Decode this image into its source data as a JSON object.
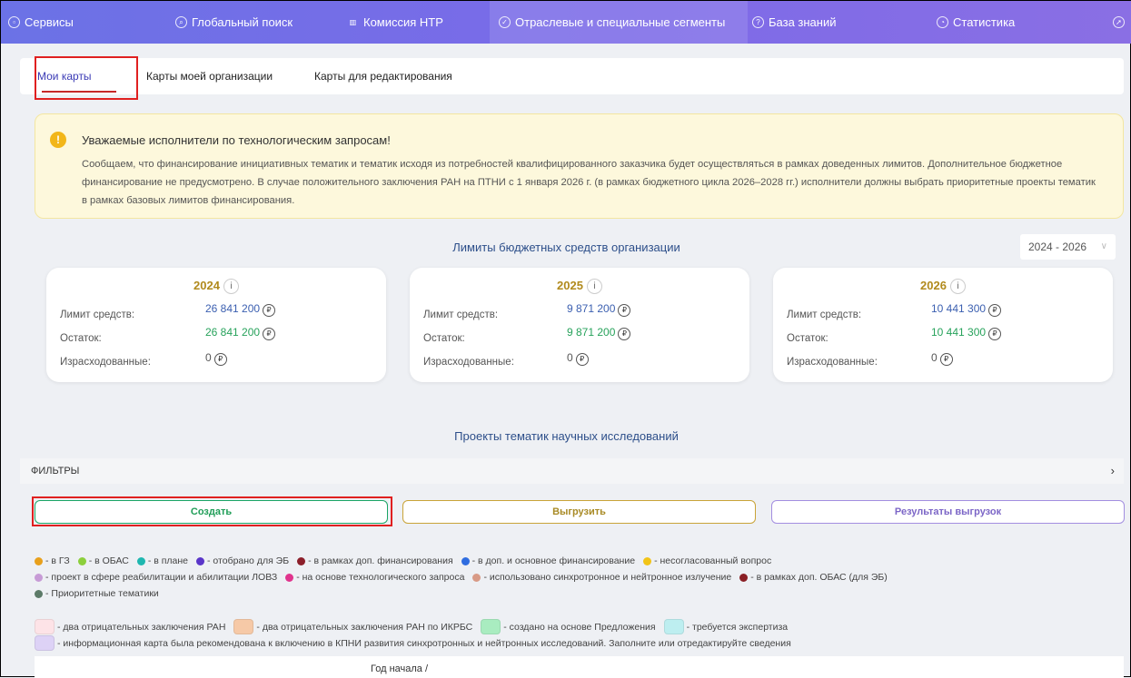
{
  "nav": {
    "items": [
      {
        "label": "Сервисы",
        "icon": "grid-icon"
      },
      {
        "label": "Глобальный поиск",
        "icon": "search-icon"
      },
      {
        "label": "Комиссия НТР",
        "icon": "building-icon"
      },
      {
        "label": "Отраслевые и специальные сегменты",
        "icon": "check-circle-icon"
      },
      {
        "label": "База знаний",
        "icon": "help-icon"
      },
      {
        "label": "Статистика",
        "icon": "chart-icon"
      }
    ]
  },
  "tabs": [
    {
      "label": "Мои карты"
    },
    {
      "label": "Карты моей организации"
    },
    {
      "label": "Карты для редактирования"
    }
  ],
  "alert": {
    "title": "Уважаемые исполнители по технологическим запросам!",
    "text": "Сообщаем, что финансирование инициативных тематик и тематик исходя из потребностей квалифицированного заказчика будет осуществляться в рамках доведенных лимитов. Дополнительное бюджетное финансирование не предусмотрено. В случае положительного заключения РАН на ПТНИ с 1 января 2026 г. (в рамках бюджетного цикла 2026–2028 гг.) исполнители должны выбрать приоритетные проекты тематик в рамках базовых лимитов финансирования."
  },
  "limits": {
    "title": "Лимиты бюджетных средств организации",
    "period": "2024 - 2026",
    "labels": {
      "limit": "Лимит средств:",
      "rest": "Остаток:",
      "spent": "Израсходованные:"
    },
    "years": [
      {
        "year": "2024",
        "limit": "26 841 200",
        "rest": "26 841 200",
        "spent": "0"
      },
      {
        "year": "2025",
        "limit": "9 871 200",
        "rest": "9 871 200",
        "spent": "0"
      },
      {
        "year": "2026",
        "limit": "10 441 300",
        "rest": "10 441 300",
        "spent": "0"
      }
    ],
    "currency_glyph": "₽",
    "info_glyph": "i"
  },
  "projects": {
    "title": "Проекты тематик научных исследований",
    "filters_label": "ФИЛЬТРЫ",
    "buttons": {
      "create": "Создать",
      "export": "Выгрузить",
      "results": "Результаты выгрузок"
    }
  },
  "legend": {
    "row1": [
      {
        "color": "#e8a01c",
        "text": "- в ГЗ"
      },
      {
        "color": "#8ccf3c",
        "text": "- в ОБАС"
      },
      {
        "color": "#1fb7b0",
        "text": "- в плане"
      },
      {
        "color": "#5a35c9",
        "text": "- отобрано для ЭБ"
      },
      {
        "color": "#8c1f2a",
        "text": "- в рамках доп. финансирования"
      },
      {
        "color": "#2f6de0",
        "text": "- в доп. и основное финансирование"
      },
      {
        "color": "#f2c417",
        "text": "- несогласованный вопрос"
      }
    ],
    "row2": [
      {
        "color": "#c79bd6",
        "text": "- проект в сфере реабилитации и абилитации ЛОВЗ"
      },
      {
        "color": "#e0348d",
        "text": "- на основе технологического запроса"
      },
      {
        "color": "#d89a86",
        "text": "- использовано синхротронное и нейтронное излучение"
      },
      {
        "color": "#8a1f25",
        "text": "- в рамках доп. ОБАС (для ЭБ)"
      }
    ],
    "row3": [
      {
        "color": "#5c7a68",
        "text": "- Приоритетные тематики"
      }
    ],
    "boxes1": [
      {
        "color": "#fde3e7",
        "text": "- два отрицательных заключения РАН"
      },
      {
        "color": "#f6c9a7",
        "text": "- два отрицательных заключения РАН по ИКРБС"
      },
      {
        "color": "#a9ecc0",
        "text": "- создано на основе Предложения"
      },
      {
        "color": "#bdeef0",
        "text": "- требуется экспертиза"
      }
    ],
    "boxes2": [
      {
        "color": "#ddd2f6",
        "text": "- информационная карта была рекомендована к включению в КПНИ развития синхротронных и нейтронных исследований. Заполните или отредактируйте сведения"
      }
    ]
  },
  "table": {
    "head_text": "Год начала /"
  }
}
